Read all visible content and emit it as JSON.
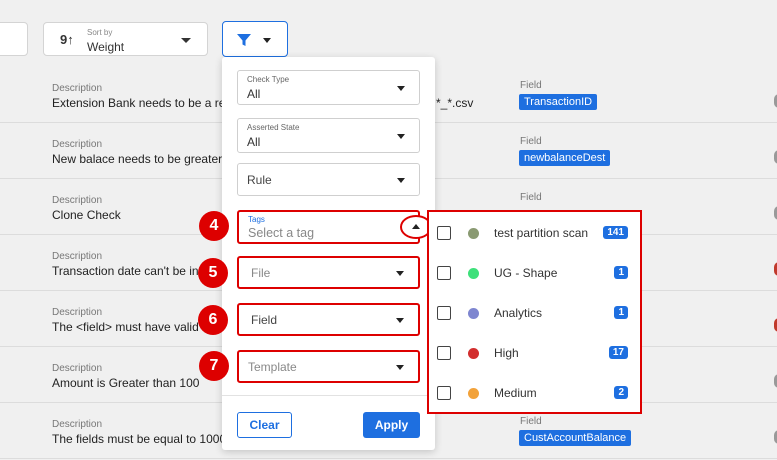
{
  "toolbar": {
    "sort": {
      "label": "Sort by",
      "value": "Weight"
    }
  },
  "rows": [
    {
      "desc_label": "Description",
      "desc": "Extension Bank needs to be a rep",
      "extra": "*_*.csv",
      "field_label": "Field",
      "field": "TransactionID"
    },
    {
      "desc_label": "Description",
      "desc": "New balace needs to be greater",
      "extra": "",
      "field_label": "Field",
      "field": "newbalanceDest"
    },
    {
      "desc_label": "Description",
      "desc": "Clone Check",
      "extra": "",
      "field_label": "Field",
      "field": ""
    },
    {
      "desc_label": "Description",
      "desc": "Transaction date can't be in",
      "extra": "",
      "field_label": "",
      "field": ""
    },
    {
      "desc_label": "Description",
      "desc": "The <field> must have valid",
      "extra": "",
      "field_label": "",
      "field": ""
    },
    {
      "desc_label": "Description",
      "desc": "Amount is Greater than 100",
      "extra": "",
      "field_label": "",
      "field": ""
    },
    {
      "desc_label": "Description",
      "desc": "The fields must be equal to 1000",
      "extra": "",
      "field_label": "Field",
      "field": "CustAccountBalance"
    }
  ],
  "filter": {
    "check_type": {
      "label": "Check Type",
      "value": "All"
    },
    "asserted_state": {
      "label": "Asserted State",
      "value": "All"
    },
    "rule": {
      "value": "Rule"
    },
    "tags": {
      "label": "Tags",
      "placeholder": "Select a tag"
    },
    "file": {
      "value": "File"
    },
    "field": {
      "value": "Field"
    },
    "template": {
      "value": "Template"
    },
    "clear_label": "Clear",
    "apply_label": "Apply"
  },
  "steps": [
    "4",
    "5",
    "6",
    "7"
  ],
  "tags": [
    {
      "name": "test partition scan",
      "count": "141",
      "color": "#8a9a72"
    },
    {
      "name": "UG - Shape",
      "count": "1",
      "color": "#3ee07a"
    },
    {
      "name": "Analytics",
      "count": "1",
      "color": "#7e86d0"
    },
    {
      "name": "High",
      "count": "17",
      "color": "#d22e2e"
    },
    {
      "name": "Medium",
      "count": "2",
      "color": "#f2a23a"
    }
  ],
  "colors": {
    "accent": "#1e6fe0",
    "highlight": "#dd0000"
  }
}
